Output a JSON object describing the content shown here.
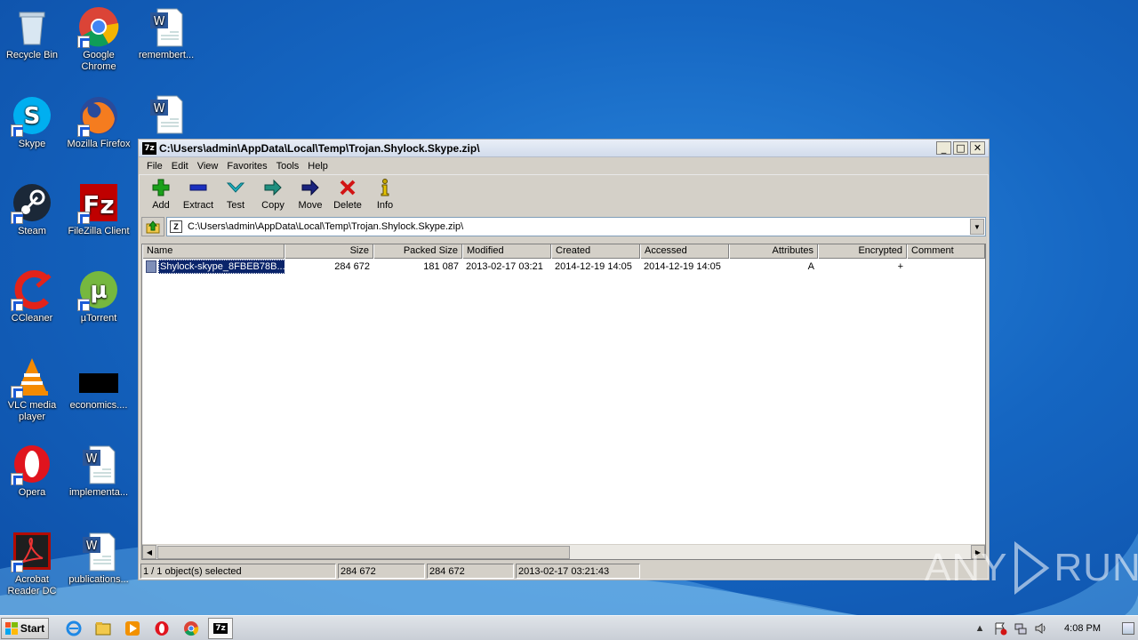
{
  "desktop": {
    "icons": [
      {
        "label": "Recycle Bin",
        "icon": "recycle-bin-icon"
      },
      {
        "label": "Google Chrome",
        "icon": "chrome-icon"
      },
      {
        "label": "remembert...",
        "icon": "word-doc-icon"
      },
      {
        "label": "Skype",
        "icon": "skype-icon"
      },
      {
        "label": "Mozilla Firefox",
        "icon": "firefox-icon"
      },
      {
        "label": "",
        "icon": "word-doc-icon"
      },
      {
        "label": "Steam",
        "icon": "steam-icon"
      },
      {
        "label": "FileZilla Client",
        "icon": "filezilla-icon"
      },
      {
        "label": "CCleaner",
        "icon": "ccleaner-icon"
      },
      {
        "label": "µTorrent",
        "icon": "utorrent-icon"
      },
      {
        "label": "VLC media player",
        "icon": "vlc-icon"
      },
      {
        "label": "economics....",
        "icon": "black-file-icon"
      },
      {
        "label": "Opera",
        "icon": "opera-icon"
      },
      {
        "label": "implementa...",
        "icon": "word-doc-icon"
      },
      {
        "label": "Acrobat Reader DC",
        "icon": "acrobat-icon"
      },
      {
        "label": "publications...",
        "icon": "word-doc-icon"
      }
    ]
  },
  "window": {
    "title": "C:\\Users\\admin\\AppData\\Local\\Temp\\Trojan.Shylock.Skype.zip\\",
    "app_icon_text": "7z",
    "controls": {
      "minimize": "_",
      "maximize": "□",
      "close": "✕"
    }
  },
  "menu": [
    "File",
    "Edit",
    "View",
    "Favorites",
    "Tools",
    "Help"
  ],
  "toolbar": [
    {
      "label": "Add",
      "icon": "add-icon",
      "color": "#1aa01a"
    },
    {
      "label": "Extract",
      "icon": "extract-icon",
      "color": "#1a2fbf"
    },
    {
      "label": "Test",
      "icon": "test-icon",
      "color": "#1fb6c4"
    },
    {
      "label": "Copy",
      "icon": "copy-icon",
      "color": "#1f8f7f"
    },
    {
      "label": "Move",
      "icon": "move-icon",
      "color": "#1a237e"
    },
    {
      "label": "Delete",
      "icon": "delete-icon",
      "color": "#d21414"
    },
    {
      "label": "Info",
      "icon": "info-icon",
      "color": "#c8a800"
    }
  ],
  "address": {
    "path": "C:\\Users\\admin\\AppData\\Local\\Temp\\Trojan.Shylock.Skype.zip\\"
  },
  "columns": [
    "Name",
    "Size",
    "Packed Size",
    "Modified",
    "Created",
    "Accessed",
    "Attributes",
    "Encrypted",
    "Comment"
  ],
  "rows": [
    {
      "name": "Shylock-skype_8FBEB78B...",
      "size": "284 672",
      "packed": "181 087",
      "modified": "2013-02-17 03:21",
      "created": "2014-12-19 14:05",
      "accessed": "2014-12-19 14:05",
      "attributes": "A",
      "encrypted": "+",
      "comment": ""
    }
  ],
  "status": {
    "selected": "1 / 1 object(s) selected",
    "size": "284 672",
    "packed": "284 672",
    "modified": "2013-02-17 03:21:43"
  },
  "taskbar": {
    "start_label": "Start",
    "clock": "4:08 PM"
  },
  "watermark": {
    "left": "ANY",
    "right": "RUN"
  }
}
